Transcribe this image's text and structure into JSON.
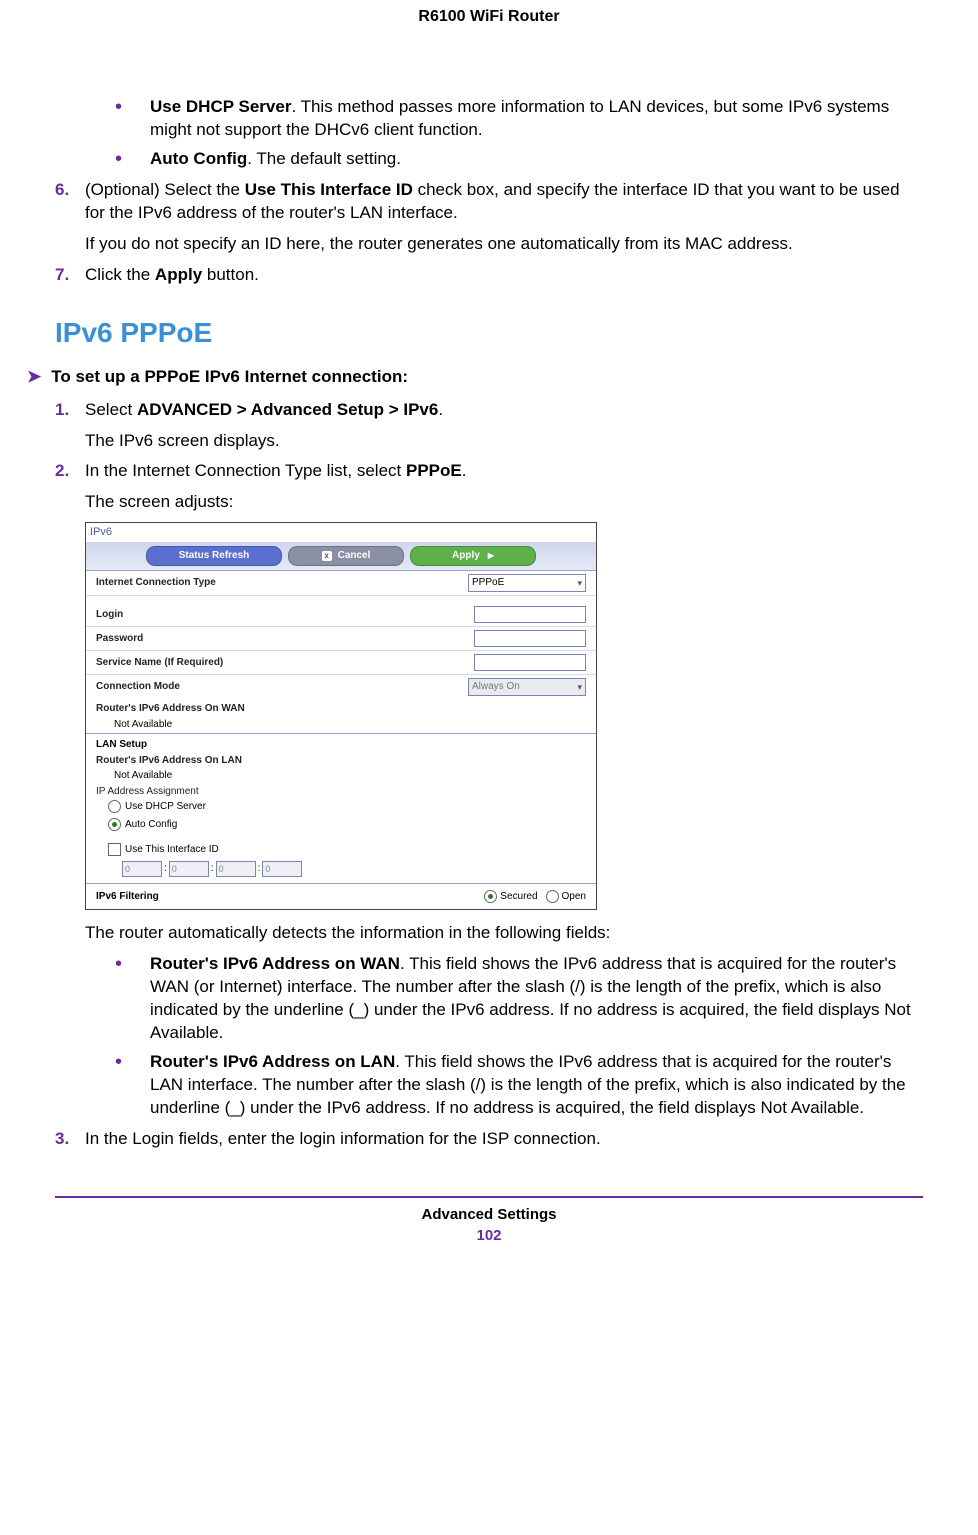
{
  "header": {
    "product": "R6100 WiFi Router"
  },
  "intro_bullets": [
    {
      "term": "Use DHCP Server",
      "rest": ". This method passes more information to LAN devices, but some IPv6 systems might not support the DHCv6 client function."
    },
    {
      "term": "Auto Config",
      "rest": ". The default setting."
    }
  ],
  "step6": {
    "num": "6.",
    "line1_pre": "(Optional) Select the ",
    "line1_bold": "Use This Interface ID",
    "line1_post": " check box, and specify the interface ID that you want to be used for the IPv6 address of the router's LAN interface.",
    "line2": "If you do not specify an ID here, the router generates one automatically from its MAC address."
  },
  "step7": {
    "num": "7.",
    "pre": "Click the ",
    "bold": "Apply",
    "post": " button."
  },
  "section_heading": "IPv6 PPPoE",
  "task": "To set up a PPPoE IPv6 Internet connection:",
  "pppoe_steps": {
    "s1": {
      "num": "1.",
      "pre": "Select ",
      "bold": "ADVANCED > Advanced Setup > IPv6",
      "post": ".",
      "after": "The IPv6 screen displays."
    },
    "s2": {
      "num": "2.",
      "pre": "In the Internet Connection Type list, select ",
      "bold": "PPPoE",
      "post": ".",
      "after": "The screen adjusts:"
    },
    "detect_line": "The router automatically detects the information in the following fields:",
    "detect_bullets": [
      {
        "term": "Router's IPv6 Address on WAN",
        "rest": ". This field shows the IPv6 address that is acquired for the router's WAN (or Internet) interface. The number after the slash (/) is the length of the prefix, which is also indicated by the underline (_) under the IPv6 address. If no address is acquired, the field displays Not Available."
      },
      {
        "term": "Router's IPv6 Address on LAN",
        "rest": ". This field shows the IPv6 address that is acquired for the router's LAN interface. The number after the slash (/) is the length of the prefix, which is also indicated by the underline (_) under the IPv6 address. If no address is acquired, the field displays Not Available."
      }
    ],
    "s3": {
      "num": "3.",
      "text": "In the Login fields, enter the login information for the ISP connection."
    }
  },
  "ui": {
    "title": "IPv6",
    "buttons": {
      "refresh": "Status Refresh",
      "cancel": "Cancel",
      "apply": "Apply"
    },
    "rows": {
      "conn_type_label": "Internet Connection Type",
      "conn_type_value": "PPPoE",
      "login": "Login",
      "password": "Password",
      "service": "Service Name (If Required)",
      "conn_mode_label": "Connection Mode",
      "conn_mode_value": "Always On",
      "wan_addr_label": "Router's IPv6 Address On WAN",
      "not_available": "Not Available",
      "lan_setup": "LAN Setup",
      "lan_addr_label": "Router's IPv6 Address On LAN",
      "ip_assign": "IP Address Assignment",
      "radio_dhcp": "Use DHCP Server",
      "radio_auto": "Auto Config",
      "check_iface": "Use This Interface ID",
      "seg": "0",
      "filter_label": "IPv6 Filtering",
      "filter_secured": "Secured",
      "filter_open": "Open"
    }
  },
  "footer": {
    "section": "Advanced Settings",
    "page": "102"
  }
}
